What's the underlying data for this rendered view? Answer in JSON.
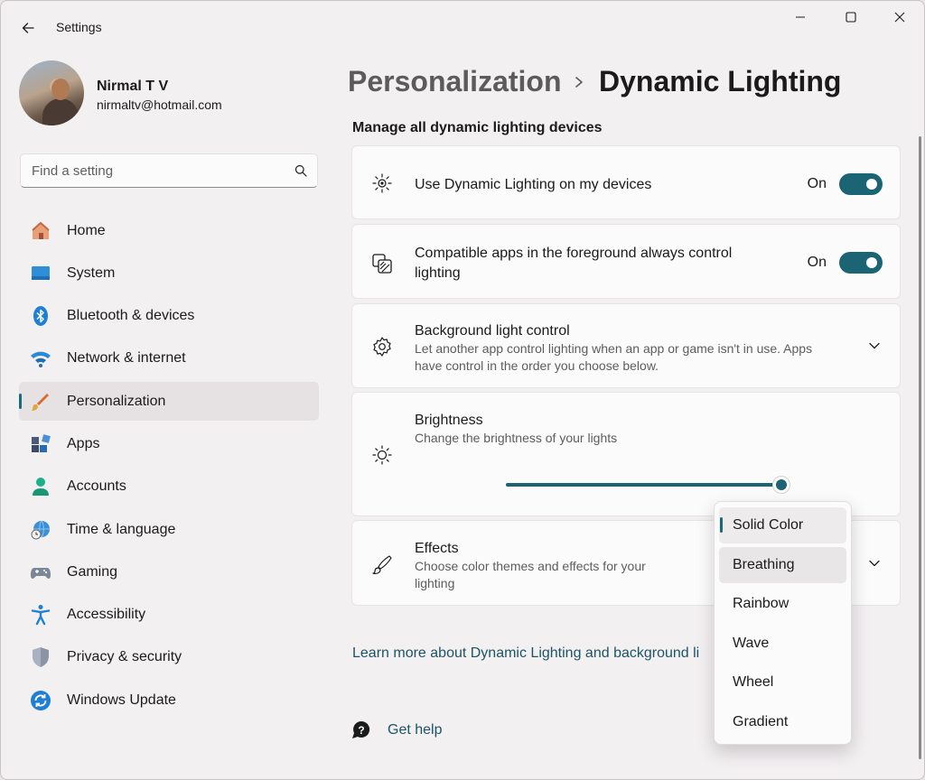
{
  "window": {
    "title": "Settings"
  },
  "profile": {
    "name": "Nirmal T V",
    "email": "nirmaltv@hotmail.com"
  },
  "search": {
    "placeholder": "Find a setting"
  },
  "sidebar": {
    "items": [
      {
        "label": "Home",
        "icon": "home-icon"
      },
      {
        "label": "System",
        "icon": "system-icon"
      },
      {
        "label": "Bluetooth & devices",
        "icon": "bluetooth-icon"
      },
      {
        "label": "Network & internet",
        "icon": "wifi-icon"
      },
      {
        "label": "Personalization",
        "icon": "brush-icon",
        "active": true
      },
      {
        "label": "Apps",
        "icon": "apps-icon"
      },
      {
        "label": "Accounts",
        "icon": "accounts-icon"
      },
      {
        "label": "Time & language",
        "icon": "globe-clock-icon"
      },
      {
        "label": "Gaming",
        "icon": "gamepad-icon"
      },
      {
        "label": "Accessibility",
        "icon": "accessibility-icon"
      },
      {
        "label": "Privacy & security",
        "icon": "shield-icon"
      },
      {
        "label": "Windows Update",
        "icon": "update-icon"
      }
    ]
  },
  "breadcrumb": {
    "parent": "Personalization",
    "current": "Dynamic Lighting"
  },
  "main": {
    "section_heading": "Manage all dynamic lighting devices",
    "cards": {
      "use_dynamic": {
        "title": "Use Dynamic Lighting on my devices",
        "state": "On",
        "enabled": true
      },
      "compatible_apps": {
        "title_line1": "Compatible apps in the foreground always control",
        "title_line2": "lighting",
        "state": "On",
        "enabled": true
      },
      "background_control": {
        "title": "Background light control",
        "sub_line1": "Let another app control lighting when an app or game isn't in use. Apps",
        "sub_line2": "have control in the order you choose below."
      },
      "brightness": {
        "title": "Brightness",
        "subtitle": "Change the brightness of your lights",
        "value_percent": 100
      },
      "effects": {
        "title": "Effects",
        "sub_line1": "Choose color themes and effects for your",
        "sub_line2": "lighting"
      }
    },
    "learn_more": "Learn more about Dynamic Lighting and background li",
    "get_help": "Get help"
  },
  "effects_dropdown": {
    "options": [
      "Solid Color",
      "Breathing",
      "Rainbow",
      "Wave",
      "Wheel",
      "Gradient"
    ],
    "selected": "Solid Color",
    "hovered": "Breathing"
  },
  "colors": {
    "accent": "#1b6473",
    "link": "#1b5466",
    "background": "#f3f0f2",
    "card": "#fbfbfb"
  }
}
